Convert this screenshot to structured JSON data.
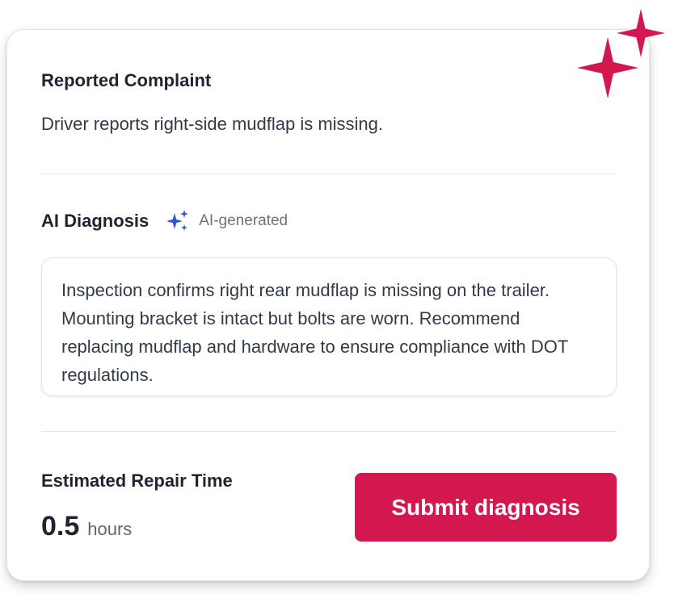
{
  "complaint": {
    "title": "Reported Complaint",
    "text": "Driver reports right-side mudflap is missing."
  },
  "diagnosis": {
    "title": "AI Diagnosis",
    "badge": "AI-generated",
    "badge_icon": "sparkles-icon",
    "text": "Inspection confirms right rear mudflap is missing on the trailer. Mounting bracket is intact but bolts are worn. Recommend replacing mudflap and hardware to ensure compliance with DOT regulations."
  },
  "repair_time": {
    "title": "Estimated Repair Time",
    "value": "0.5",
    "unit": "hours"
  },
  "actions": {
    "submit_label": "Submit diagnosis"
  },
  "colors": {
    "accent": "#d3184f",
    "ai_icon": "#2f5bc7",
    "text_primary": "#1f2430",
    "text_secondary": "#6b7280"
  },
  "decorations": {
    "corner_icon": "sparkle-icon"
  }
}
